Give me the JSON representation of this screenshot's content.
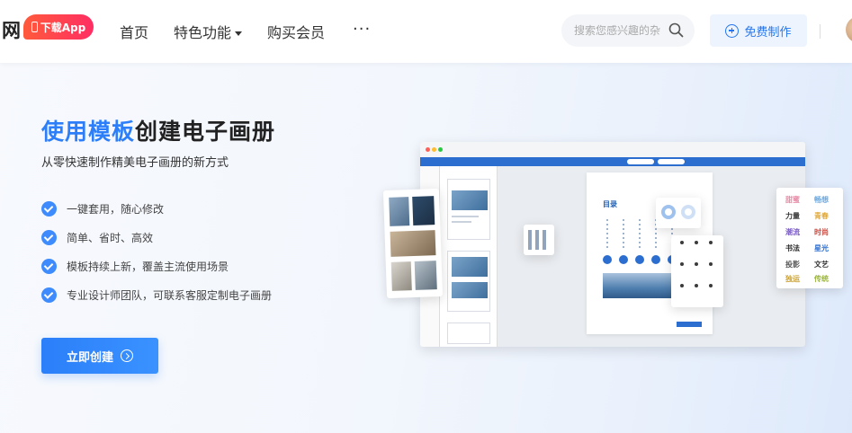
{
  "nav": {
    "logo_char": "网",
    "app_button": "下载App",
    "items": [
      {
        "label": "首页",
        "has_caret": false
      },
      {
        "label": "特色功能",
        "has_caret": true
      },
      {
        "label": "购买会员",
        "has_caret": false
      }
    ],
    "more": "···",
    "search_placeholder": "搜索您感兴趣的杂",
    "make_button": "免费制作"
  },
  "hero": {
    "title_highlight": "使用模板",
    "title_rest": "创建电子画册",
    "subtitle": "从零快速制作精美电子画册的新方式",
    "features": [
      "一键套用，随心修改",
      "简单、省时、高效",
      "模板持续上新，覆盖主流使用场景",
      "专业设计师团队，可联系客服定制电子画册"
    ],
    "cta": "立即创建"
  },
  "illustration": {
    "page_title": "目录",
    "words": [
      "甜蜜",
      "畅想",
      "力量",
      "潮流",
      "书法",
      "时尚",
      "投影",
      "传统",
      "独运",
      "青春",
      "星光",
      "文艺",
      "卡通",
      "浪漫"
    ]
  },
  "colors": {
    "accent": "#2d7ff9",
    "app_button": "#ff3d55",
    "check": "#3d8bfd"
  }
}
